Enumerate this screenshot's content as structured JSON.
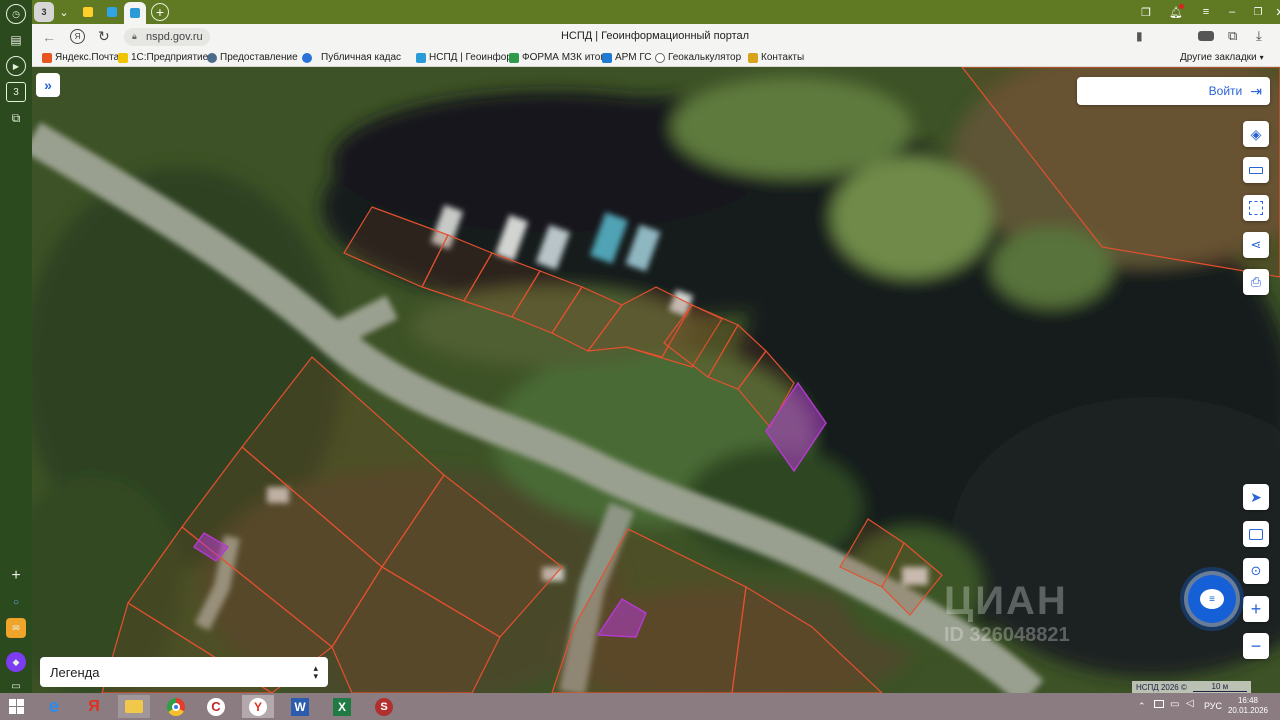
{
  "browser": {
    "page_title": "НСПД | Геоинформационный портал",
    "url": "nspd.gov.ru",
    "sidebar_badge": "3",
    "bookmarks": [
      {
        "label": "Яндекс.Почта",
        "color": "#e8561f"
      },
      {
        "label": "1С:Предприятие",
        "color": "#f0c400"
      },
      {
        "label": "Предоставление",
        "color": "#4b6b8a"
      },
      {
        "label": "Публичная кадас",
        "color": "#2a72d8"
      },
      {
        "label": "НСПД | Геоинфор",
        "color": "#2a9bd8"
      },
      {
        "label": "ФОРМА МЗК итог",
        "color": "#2e9b4b"
      },
      {
        "label": "АРМ ГС",
        "color": "#1f7ad1"
      },
      {
        "label": "Геокалькулятор",
        "color": "#6a6a6a"
      },
      {
        "label": "Контакты",
        "color": "#d9a21b"
      }
    ],
    "other_bookmarks": "Другие закладки"
  },
  "map": {
    "login_label": "Войти",
    "legend_label": "Легенда",
    "scale_label": "10 м",
    "copyright": "НСПД 2026 ©",
    "watermark_brand": "ЦИАН",
    "watermark_id": "ID 326048821",
    "parcel_color": "#e5502f",
    "highlight_color": "#b53ad0"
  },
  "taskbar": {
    "lang": "РУС",
    "time": "16:48",
    "date": "20.01.2026"
  }
}
